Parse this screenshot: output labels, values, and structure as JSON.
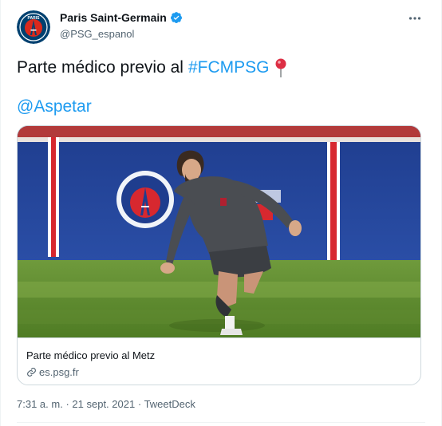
{
  "author": {
    "display_name": "Paris Saint-Germain",
    "handle": "@PSG_espanol",
    "avatar_icon": "psg-crest-icon",
    "verified": true
  },
  "tweet": {
    "text": "Parte médico previo al",
    "hashtag": "#FCMPSG",
    "emoji_icon": "round-pushpin-icon",
    "mention": "@Aspetar"
  },
  "card": {
    "image_desc": "player-training-photo",
    "title": "Parte médico previo al Metz",
    "domain": "es.psg.fr"
  },
  "meta": {
    "time": "7:31 a. m.",
    "date": "21 sept. 2021",
    "source": "TweetDeck",
    "separator": "·"
  },
  "colors": {
    "link": "#1d9bf0",
    "psg_navy": "#004170",
    "psg_red": "#da291c",
    "text_secondary": "#536471"
  }
}
